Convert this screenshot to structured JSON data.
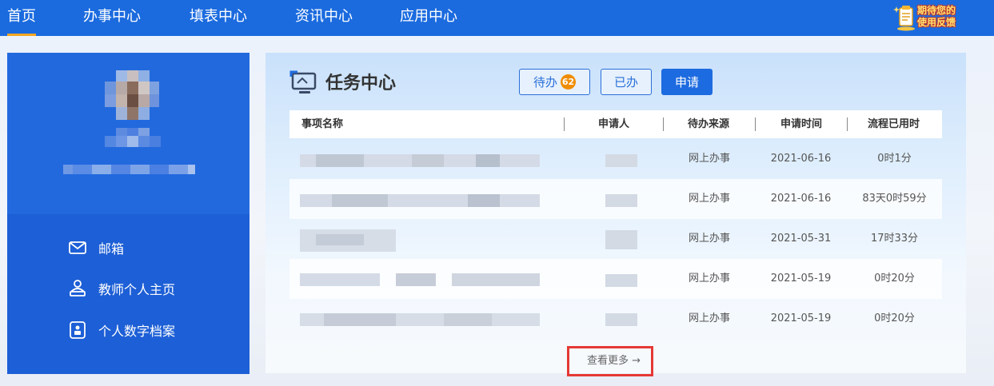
{
  "nav": {
    "items": [
      {
        "label": "首页",
        "active": true
      },
      {
        "label": "办事中心",
        "active": false
      },
      {
        "label": "填表中心",
        "active": false
      },
      {
        "label": "资讯中心",
        "active": false
      },
      {
        "label": "应用中心",
        "active": false
      }
    ],
    "feedback_line1": "期待您的",
    "feedback_line2": "使用反馈"
  },
  "sidebar": {
    "menu": [
      {
        "label": "邮箱",
        "icon": "mail-icon"
      },
      {
        "label": "教师个人主页",
        "icon": "teacher-home-icon"
      },
      {
        "label": "个人数字档案",
        "icon": "archive-icon"
      }
    ]
  },
  "task_center": {
    "title": "任务中心",
    "tabs": {
      "todo": "待办",
      "todo_count": "62",
      "done": "已办",
      "apply": "申请"
    },
    "columns": [
      "事项名称",
      "申请人",
      "待办来源",
      "申请时间",
      "流程已用时"
    ],
    "rows": [
      {
        "source": "网上办事",
        "date": "2021-06-16",
        "elapsed": "0时1分"
      },
      {
        "source": "网上办事",
        "date": "2021-06-16",
        "elapsed": "83天0时59分"
      },
      {
        "source": "网上办事",
        "date": "2021-05-31",
        "elapsed": "17时33分"
      },
      {
        "source": "网上办事",
        "date": "2021-05-19",
        "elapsed": "0时20分"
      },
      {
        "source": "网上办事",
        "date": "2021-05-19",
        "elapsed": "0时20分"
      }
    ],
    "more": "查看更多 →"
  },
  "colors": {
    "nav_bg": "#1b6bdf",
    "active_underline": "#f5a623",
    "sidebar_bg": "#1d5fd6",
    "accent": "#1d6be0",
    "badge": "#f08c00",
    "highlight_box": "#e53935"
  }
}
